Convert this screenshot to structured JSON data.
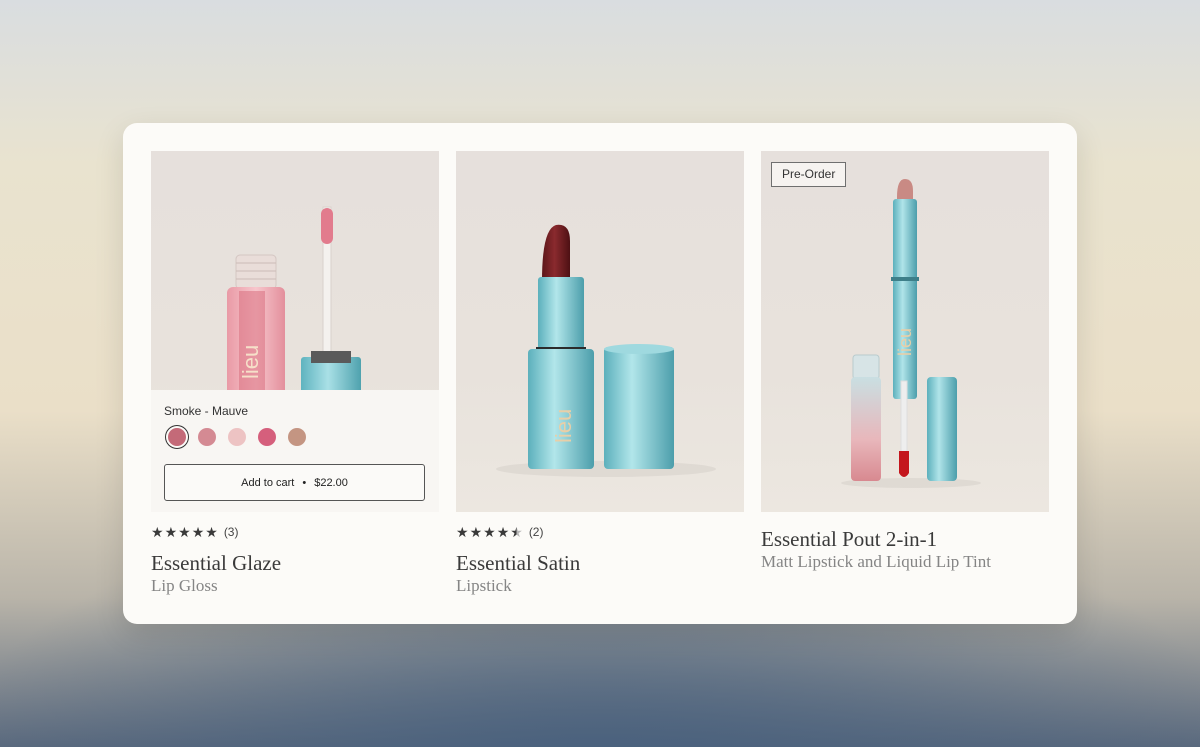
{
  "colors": {
    "panel_bg": "#fcfbf8",
    "text_primary": "#3a3a3a",
    "text_secondary": "#858585",
    "packaging_teal": "#7fc6cf"
  },
  "products": [
    {
      "title": "Essential Glaze",
      "subtitle": "Lip Gloss",
      "rating": 5,
      "review_count": "(3)",
      "quick_add": {
        "selected_shade": "Smoke - Mauve",
        "swatches": [
          "#c46a78",
          "#d48a93",
          "#edc3c3",
          "#d55f7c",
          "#c49582"
        ],
        "selected_index": 0,
        "add_label": "Add to cart",
        "separator": "•",
        "price": "$22.00"
      },
      "brand_mark": "lieu"
    },
    {
      "title": "Essential Satin",
      "subtitle": "Lipstick",
      "rating": 4.5,
      "review_count": "(2)",
      "brand_mark": "lieu"
    },
    {
      "title": "Essential Pout 2-in-1",
      "subtitle": "Matt Lipstick and Liquid Lip Tint",
      "badge": "Pre-Order",
      "brand_mark": "lieu"
    }
  ]
}
